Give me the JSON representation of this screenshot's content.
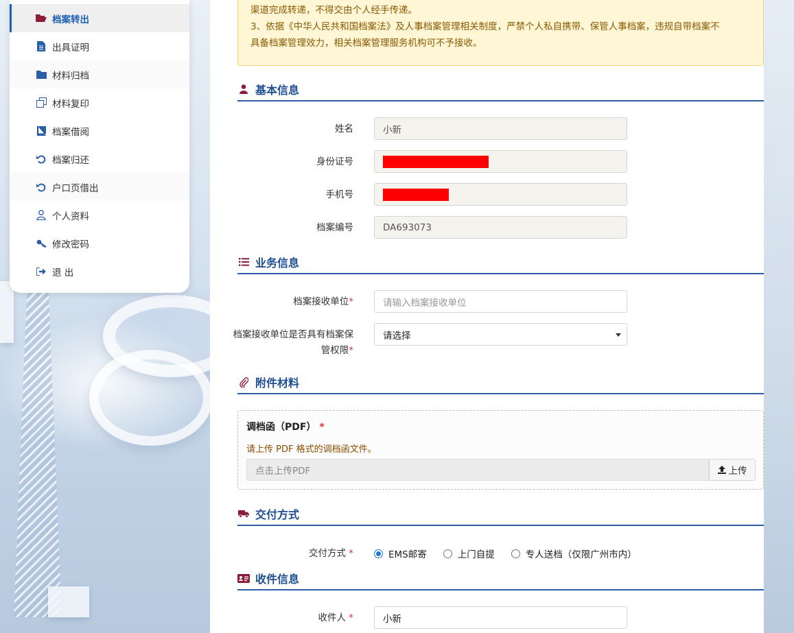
{
  "sidebar": {
    "items": [
      {
        "label": "档案转出",
        "icon": "folder-open-icon",
        "active": true
      },
      {
        "label": "出具证明",
        "icon": "file-text-icon"
      },
      {
        "label": "材料归档",
        "icon": "folder-icon"
      },
      {
        "label": "材料复印",
        "icon": "copy-icon"
      },
      {
        "label": "档案借阅",
        "icon": "book-icon"
      },
      {
        "label": "档案归还",
        "icon": "undo-icon"
      },
      {
        "label": "户口页借出",
        "icon": "undo-icon"
      },
      {
        "label": "个人资料",
        "icon": "user-icon"
      },
      {
        "label": "修改密码",
        "icon": "key-icon"
      },
      {
        "label": "退 出",
        "icon": "sign-out-icon"
      }
    ]
  },
  "notice": {
    "line1": "渠道完成转递，不得交由个人经手传递。",
    "line2": "3、依据《中华人民共和国档案法》及人事档案管理相关制度，严禁个人私自携带、保管人事档案，违规自带档案不",
    "line3": "具备档案管理效力，相关档案管理服务机构可不予接收。"
  },
  "basic_info": {
    "title": "基本信息",
    "name_label": "姓名",
    "name_value": "小新",
    "id_label": "身份证号",
    "phone_label": "手机号",
    "archive_no_label": "档案编号",
    "archive_no_value": "DA693073"
  },
  "business_info": {
    "title": "业务信息",
    "receiver_unit_label": "档案接收单位",
    "receiver_unit_placeholder": "请输入档案接收单位",
    "authority_label": "档案接收单位是否具有档案保管权限",
    "authority_value": "请选择",
    "required_mark": "*"
  },
  "attachments": {
    "title": "附件材料",
    "item_title": "调档函（PDF）",
    "required_mark": "*",
    "hint": "请上传 PDF 格式的调档函文件。",
    "upload_placeholder": "点击上传PDF",
    "upload_button": "上传"
  },
  "delivery": {
    "title": "交付方式",
    "label": "交付方式",
    "required_mark": "*",
    "options": [
      "EMS邮寄",
      "上门自提",
      "专人送档（仅限广州市内）"
    ],
    "selected": 0
  },
  "recipient": {
    "title": "收件信息",
    "name_label": "收件人",
    "required_mark": "*",
    "name_value": "小新"
  },
  "colors": {
    "accent": "#1e4f93",
    "section_icon": "#8b1c3a",
    "redaction": "#ff0000",
    "notice_bg": "#fff6d6"
  }
}
